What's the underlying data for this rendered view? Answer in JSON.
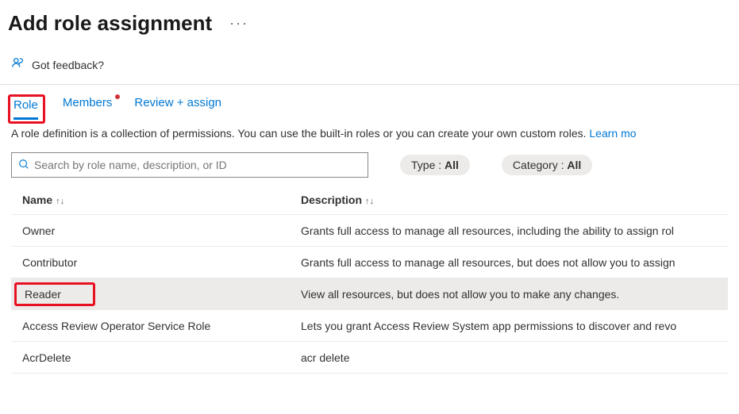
{
  "header": {
    "title": "Add role assignment",
    "more": "···"
  },
  "feedback": {
    "label": "Got feedback?"
  },
  "tabs": {
    "role": "Role",
    "members": "Members",
    "review": "Review + assign"
  },
  "description": {
    "text": "A role definition is a collection of permissions. You can use the built-in roles or you can create your own custom roles. ",
    "link": "Learn mo"
  },
  "search": {
    "placeholder": "Search by role name, description, or ID"
  },
  "filters": {
    "type_label": "Type : ",
    "type_value": "All",
    "category_label": "Category : ",
    "category_value": "All"
  },
  "columns": {
    "name": "Name",
    "description": "Description",
    "sort_up": "↑",
    "sort_both": "↑↓"
  },
  "rows": [
    {
      "name": "Owner",
      "desc": "Grants full access to manage all resources, including the ability to assign rol"
    },
    {
      "name": "Contributor",
      "desc": "Grants full access to manage all resources, but does not allow you to assign"
    },
    {
      "name": "Reader",
      "desc": "View all resources, but does not allow you to make any changes."
    },
    {
      "name": "Access Review Operator Service Role",
      "desc": "Lets you grant Access Review System app permissions to discover and revo"
    },
    {
      "name": "AcrDelete",
      "desc": "acr delete"
    }
  ]
}
